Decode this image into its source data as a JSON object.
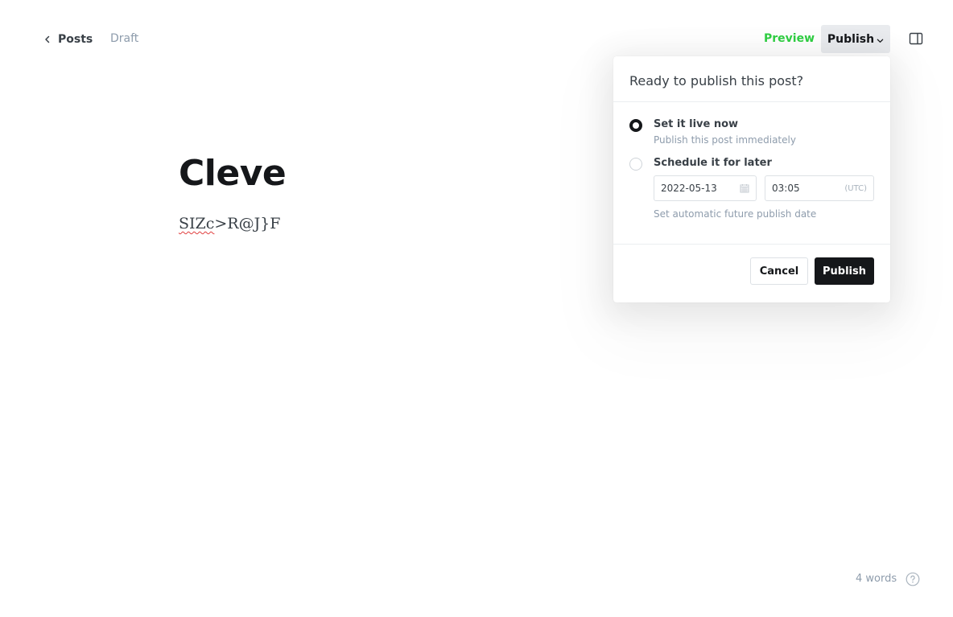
{
  "header": {
    "back_label": "Posts",
    "status": "Draft",
    "preview_label": "Preview",
    "publish_label": "Publish"
  },
  "editor": {
    "title": "Cleve",
    "body_misspelled": "SIZc",
    "body_rest": ">R@J}F"
  },
  "footer": {
    "word_count": "4 words"
  },
  "publish_menu": {
    "heading": "Ready to publish this post?",
    "options": [
      {
        "label": "Set it live now",
        "description": "Publish this post immediately",
        "selected": true
      },
      {
        "label": "Schedule it for later",
        "selected": false
      }
    ],
    "schedule": {
      "date": "2022-05-13",
      "time": "03:05",
      "timezone": "(UTC)",
      "hint": "Set automatic future publish date"
    },
    "cancel_label": "Cancel",
    "publish_label": "Publish"
  },
  "colors": {
    "accent_green": "#30cf43",
    "primary_dark": "#15171a",
    "muted": "#8e9cac"
  },
  "icons": {
    "back": "chevron-left-icon",
    "dropdown": "chevron-down-icon",
    "sidebar": "sidebar-toggle-icon",
    "calendar": "calendar-icon",
    "help": "help-icon"
  }
}
